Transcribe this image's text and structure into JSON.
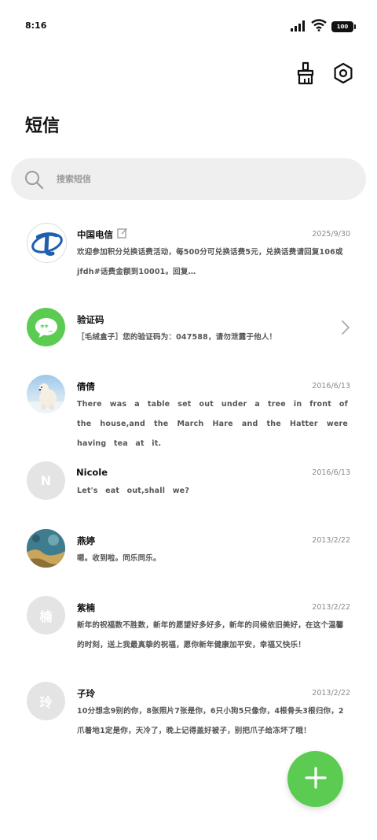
{
  "status": {
    "time": "8:16",
    "battery": "100",
    "signal_icon": "signal-icon",
    "wifi_icon": "wifi-icon"
  },
  "toolbar": {
    "clean_icon": "brush-icon",
    "settings_icon": "settings-icon"
  },
  "page": {
    "title": "短信"
  },
  "search": {
    "placeholder": "搜索短信"
  },
  "messages": [
    {
      "name": "中国电信",
      "date": "2025/9/30",
      "preview": "欢迎参加积分兑换话费活动，每500分可兑换话费5元，兑换话费请回复106或jfdh#话费金额到10001。回复…",
      "avatar": "china-telecom-logo"
    },
    {
      "name": "验证码",
      "date": "",
      "preview": "［毛绒盒子］您的验证码为：047588，请勿泄露于他人！",
      "avatar": "chat-bubble-icon"
    },
    {
      "name": "倩倩",
      "date": "2016/6/13",
      "preview": "There was a table set out under a tree in front of the house,and the March Hare and the Hatter were having tea at it.",
      "avatar": "polar-bear-photo"
    },
    {
      "name": "Nicole",
      "date": "2016/6/13",
      "preview": "Let's eat out,shall we?",
      "avatar": "N"
    },
    {
      "name": "燕婷",
      "date": "2013/2/22",
      "preview": "嗯。收到啦。同乐同乐。",
      "avatar": "landscape-photo"
    },
    {
      "name": "紫楠",
      "date": "2013/2/22",
      "preview": "新年的祝福数不胜数，新年的愿望好多好多，新年的问候依旧美好，在这个温馨的时刻，送上我最真挚的祝福，愿你新年健康加平安，幸福又快乐！",
      "avatar": "楠"
    },
    {
      "name": "子玲",
      "date": "2013/2/22",
      "preview": "10分想念9别的你，8张照片7张是你，6只小狗5只像你，4根骨头3根归你，2爪着地1定是你，天冷了，晚上记得盖好被子，别把爪子给冻坏了哦！",
      "avatar": "玲"
    }
  ],
  "fab": {
    "icon": "plus-icon"
  },
  "colors": {
    "accent": "#5bcb52",
    "telecom_blue": "#1e5fb0"
  }
}
